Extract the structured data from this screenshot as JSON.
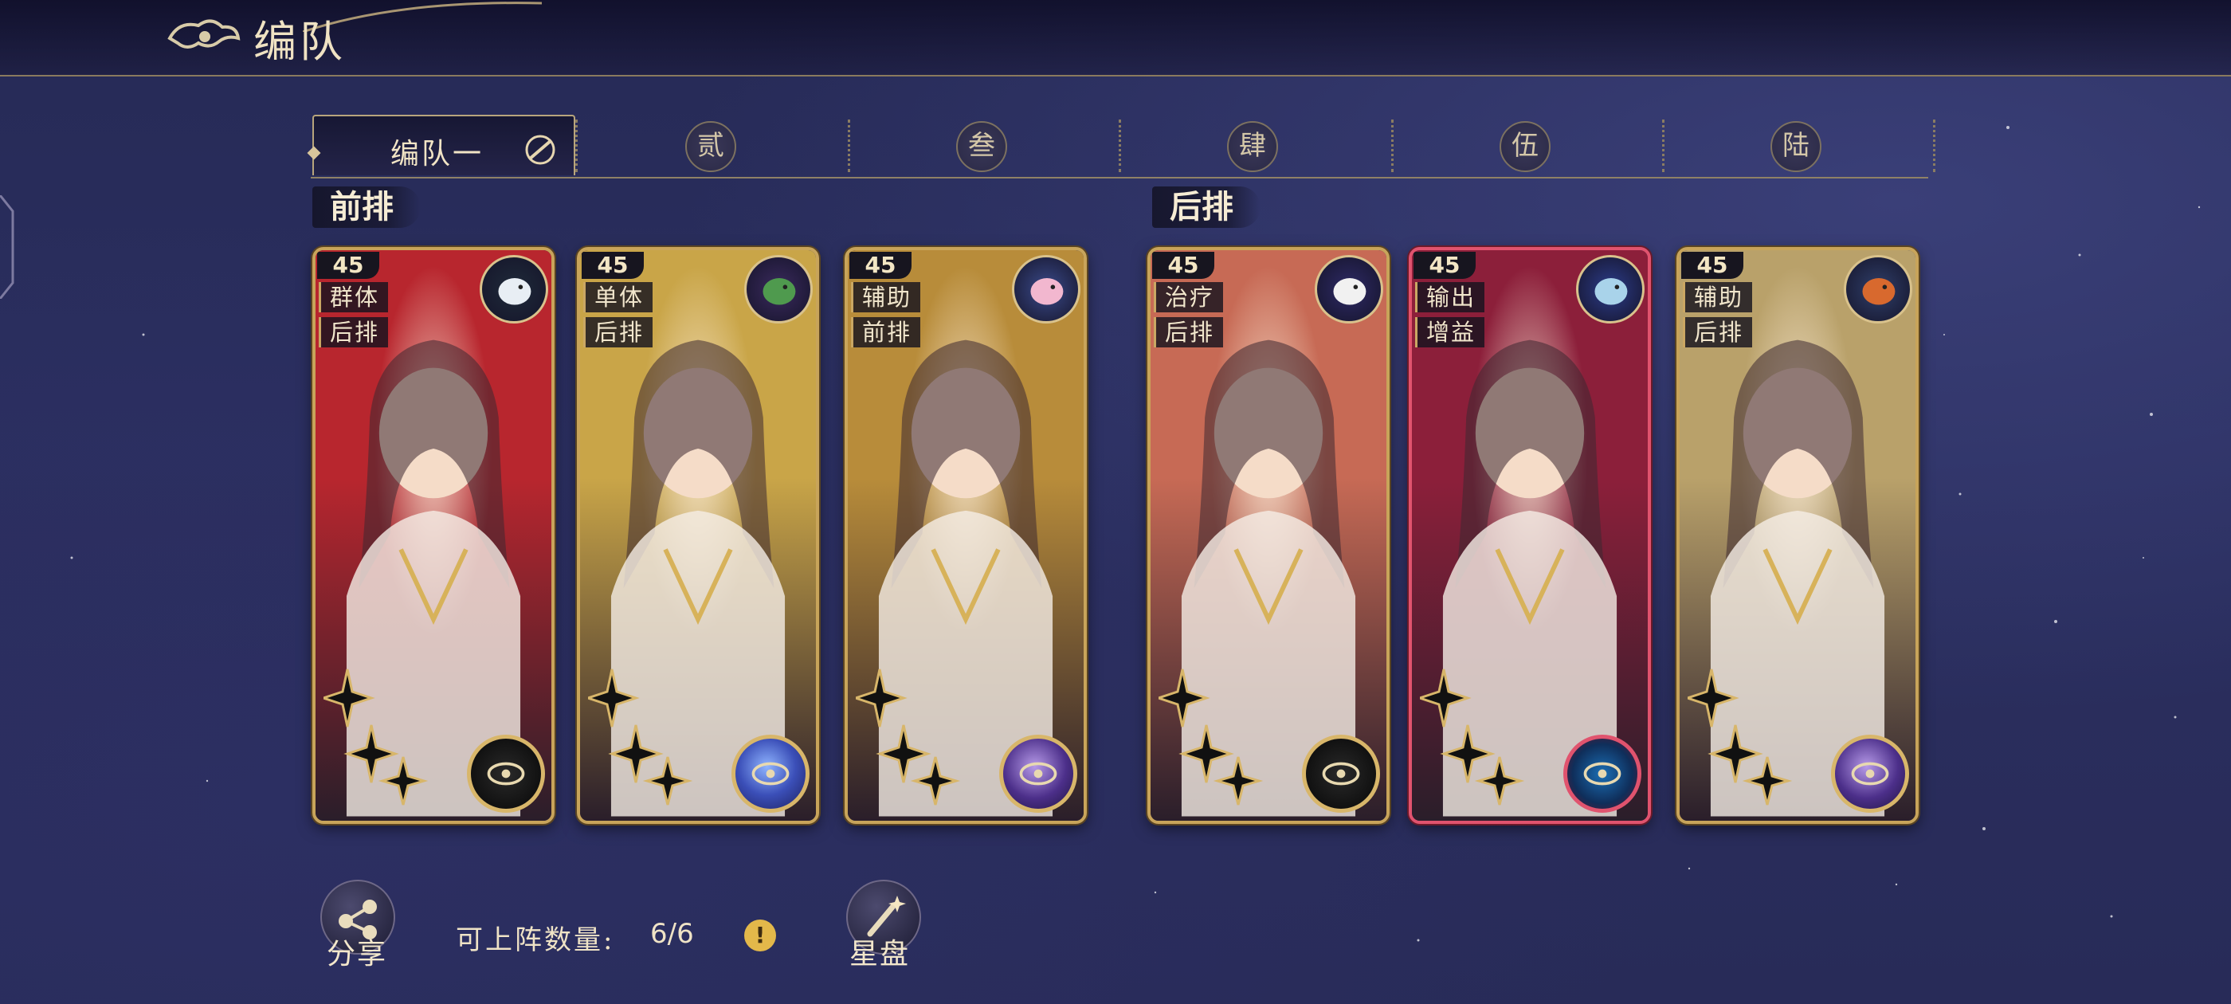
{
  "header": {
    "title": "编队"
  },
  "tabs": {
    "active_label": "编队一",
    "items": [
      "贰",
      "叁",
      "肆",
      "伍",
      "陆"
    ]
  },
  "rows": {
    "front": "前排",
    "back": "后排"
  },
  "cards": [
    {
      "level": "45",
      "tag1": "群体",
      "tag2": "后排",
      "theme": "#b8262e",
      "element": "ring-black",
      "pet": "white-wolf",
      "frame": "gold"
    },
    {
      "level": "45",
      "tag1": "单体",
      "tag2": "后排",
      "theme": "#c9a548",
      "element": "planet-blue",
      "pet": "green-dragon",
      "frame": "gold"
    },
    {
      "level": "45",
      "tag1": "辅助",
      "tag2": "前排",
      "theme": "#b88c3a",
      "element": "planet-purple",
      "pet": "pink-cat",
      "frame": "gold"
    },
    {
      "level": "45",
      "tag1": "治疗",
      "tag2": "后排",
      "theme": "#c76a55",
      "element": "ring-black",
      "pet": "white-goat",
      "frame": "gold"
    },
    {
      "level": "45",
      "tag1": "输出",
      "tag2": "增益",
      "theme": "#8c1f3a",
      "element": "compass-red",
      "pet": "ice-dragon",
      "frame": "red"
    },
    {
      "level": "45",
      "tag1": "辅助",
      "tag2": "后排",
      "theme": "#b9a16a",
      "element": "planet-purple",
      "pet": "rooster",
      "frame": "gold"
    }
  ],
  "bottom": {
    "share_label": "分享",
    "count_label": "可上阵数量:",
    "count_value": "6/6",
    "info_icon": "!",
    "starchart_label": "星盘"
  }
}
